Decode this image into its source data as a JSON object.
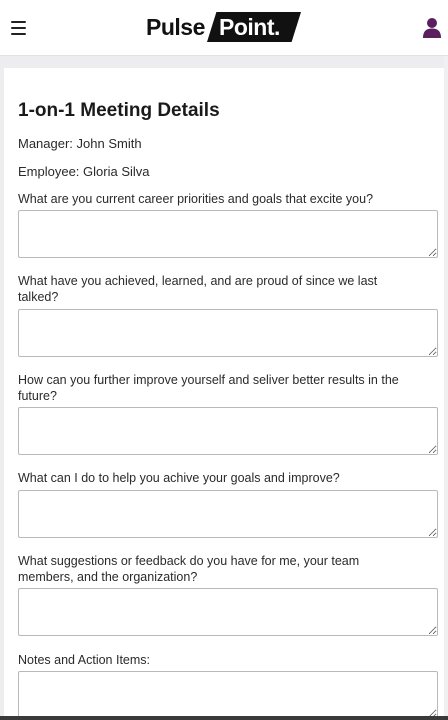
{
  "header": {
    "logo_left": "Pulse",
    "logo_right": "Point."
  },
  "page": {
    "title": "1-on-1 Meeting Details",
    "manager": "Manager: John Smith",
    "employee": "Employee: Gloria Silva"
  },
  "questions": [
    {
      "label": "What are you current career priorities and goals that excite you?",
      "value": ""
    },
    {
      "label": "What have you achieved, learned, and are proud of since we last talked?",
      "value": ""
    },
    {
      "label": "How can you further improve yourself and seliver better results in the future?",
      "value": ""
    },
    {
      "label": "What can I do to help you achive your goals and improve?",
      "value": ""
    },
    {
      "label": "What suggestions or feedback do you have for me, your team members, and the organization?",
      "value": ""
    },
    {
      "label": "Notes and Action Items:",
      "value": ""
    }
  ],
  "colors": {
    "user_icon": "#5b1f5e",
    "header_bg": "#ffffff",
    "page_bg": "#ededf0"
  }
}
